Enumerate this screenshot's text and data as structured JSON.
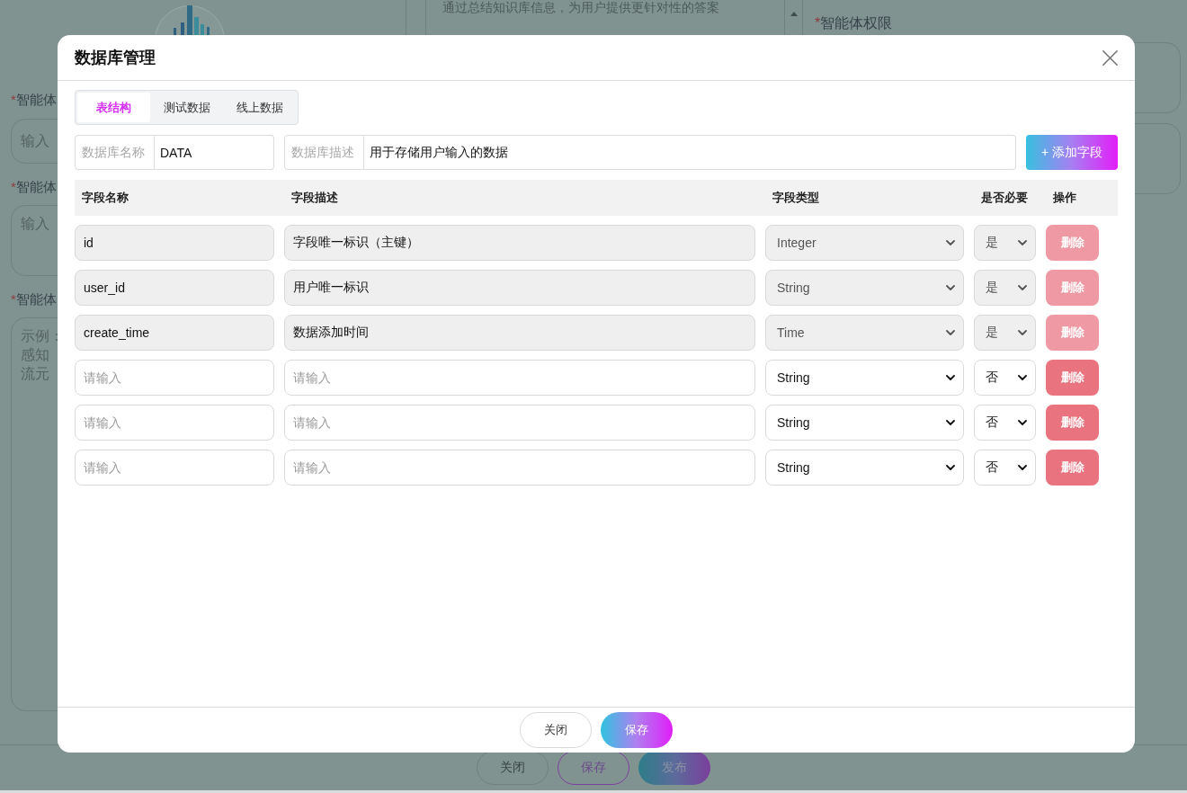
{
  "background_page": {
    "agent_form": {
      "fields": [
        {
          "kind": "input",
          "required_mark": "*",
          "label": "智能体",
          "placeholder": "输入"
        },
        {
          "kind": "textarea",
          "required_mark": "*",
          "label": "智能体",
          "placeholder": "输入"
        },
        {
          "kind": "textarea",
          "required_mark": "*",
          "label": "智能体",
          "placeholder_lines": [
            "示例：",
            "感知",
            "流元"
          ]
        }
      ]
    },
    "knowledge_panel": {
      "text": "通过总结知识库信息，为用户提供更针对性的答案"
    },
    "permissions": {
      "required_mark": "*",
      "label": "智能体权限"
    },
    "footer_buttons": [
      {
        "kind": "outline",
        "label": "关闭"
      },
      {
        "kind": "accent-outline",
        "label": "保存"
      },
      {
        "kind": "gradient",
        "label": "发布"
      }
    ]
  },
  "dialog": {
    "title": "数据库管理",
    "tabs": [
      {
        "label": "表结构",
        "selected": true
      },
      {
        "label": "测试数据",
        "selected": false
      },
      {
        "label": "线上数据",
        "selected": false
      }
    ],
    "database_name": {
      "label": "数据库名称",
      "value": "DATA"
    },
    "database_description": {
      "label": "数据库描述",
      "value": "用于存储用户输入的数据"
    },
    "add_field_button": "+ 添加字段",
    "table": {
      "columns": [
        "字段名称",
        "字段描述",
        "字段类型",
        "是否必要",
        "操作"
      ],
      "rows": [
        {
          "name": {
            "value": "id"
          },
          "description": {
            "value": "字段唯一标识（主键）"
          },
          "type": "Integer",
          "required": "是",
          "disabled": true,
          "action": "删除"
        },
        {
          "name": {
            "value": "user_id"
          },
          "description": {
            "value": "用户唯一标识"
          },
          "type": "String",
          "required": "是",
          "disabled": true,
          "action": "删除"
        },
        {
          "name": {
            "value": "create_time"
          },
          "description": {
            "value": "数据添加时间"
          },
          "type": "Time",
          "required": "是",
          "disabled": true,
          "action": "删除"
        },
        {
          "name": {
            "placeholder": "请输入"
          },
          "description": {
            "placeholder": "请输入"
          },
          "type": "String",
          "required": "否",
          "disabled": false,
          "action": "删除"
        },
        {
          "name": {
            "placeholder": "请输入"
          },
          "description": {
            "placeholder": "请输入"
          },
          "type": "String",
          "required": "否",
          "disabled": false,
          "action": "删除"
        },
        {
          "name": {
            "placeholder": "请输入"
          },
          "description": {
            "placeholder": "请输入"
          },
          "type": "String",
          "required": "否",
          "disabled": false,
          "action": "删除"
        }
      ]
    },
    "footer_buttons": [
      {
        "kind": "outline",
        "label": "关闭"
      },
      {
        "kind": "gradient",
        "label": "保存"
      }
    ]
  }
}
